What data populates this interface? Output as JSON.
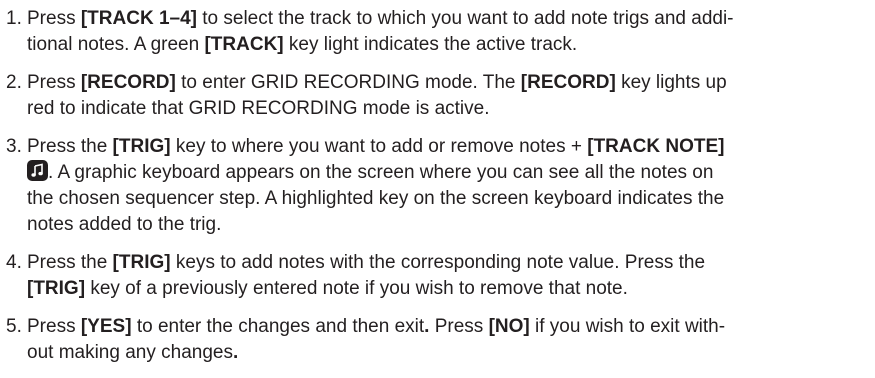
{
  "steps": [
    {
      "num": "1.",
      "parts": [
        {
          "t": "Press "
        },
        {
          "t": "[TRACK 1–4]",
          "b": true
        },
        {
          "t": " to select the track to which you want to add note trigs and addi-"
        },
        {
          "br": true
        },
        {
          "t": "tional notes. A green "
        },
        {
          "t": "[TRACK]",
          "b": true
        },
        {
          "t": " key light indicates the active track."
        }
      ]
    },
    {
      "num": "2.",
      "parts": [
        {
          "t": "Press "
        },
        {
          "t": "[RECORD]",
          "b": true
        },
        {
          "t": " to enter GRID RECORDING mode. The "
        },
        {
          "t": "[RECORD]",
          "b": true
        },
        {
          "t": " key lights up"
        },
        {
          "br": true
        },
        {
          "t": "red to indicate that GRID RECORDING mode is active."
        }
      ]
    },
    {
      "num": "3.",
      "parts": [
        {
          "t": "Press the "
        },
        {
          "t": "[TRIG]",
          "b": true
        },
        {
          "t": " key to where you want to add or remove notes + "
        },
        {
          "t": "[TRACK NOTE]",
          "b": true
        },
        {
          "br": true
        },
        {
          "icon": "note-icon"
        },
        {
          "t": ". A graphic keyboard appears on the screen where you can see all the notes on"
        },
        {
          "br": true
        },
        {
          "t": "the chosen sequencer step. A highlighted key on the screen keyboard indicates the"
        },
        {
          "br": true
        },
        {
          "t": "notes added to the trig."
        }
      ]
    },
    {
      "num": "4.",
      "parts": [
        {
          "t": "Press the "
        },
        {
          "t": "[TRIG]",
          "b": true
        },
        {
          "t": " keys to add notes with the corresponding note value. Press the"
        },
        {
          "br": true
        },
        {
          "t": "[TRIG]",
          "b": true
        },
        {
          "t": " key of a previously entered note if you wish to remove that note."
        }
      ]
    },
    {
      "num": "5.",
      "parts": [
        {
          "t": "Press "
        },
        {
          "t": "[YES]",
          "b": true
        },
        {
          "t": " to enter the changes and then exit"
        },
        {
          "t": ".",
          "b": true
        },
        {
          "t": " Press "
        },
        {
          "t": "[NO]",
          "b": true
        },
        {
          "t": " if you wish to exit with-"
        },
        {
          "br": true
        },
        {
          "t": "out making any changes"
        },
        {
          "t": ".",
          "b": true
        }
      ]
    }
  ]
}
